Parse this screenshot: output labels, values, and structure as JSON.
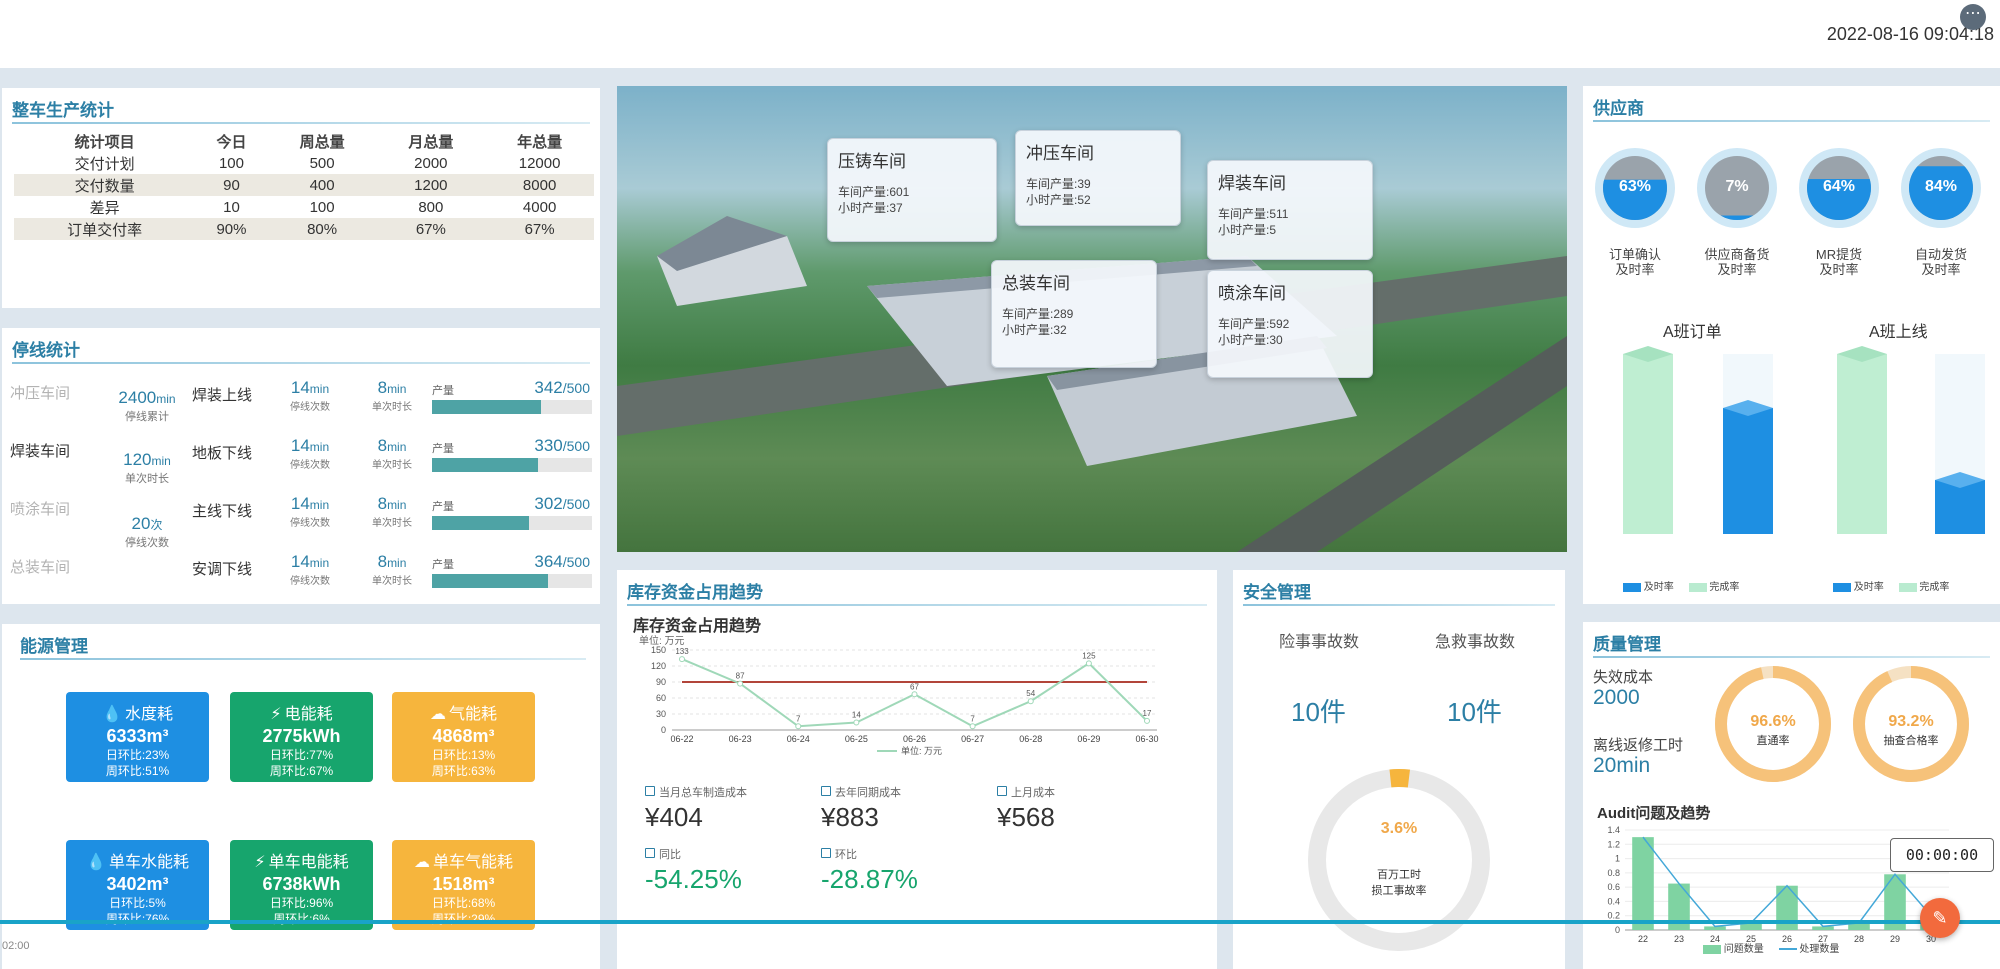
{
  "datetime": "2022-08-16 09:04:18",
  "production": {
    "title": "整车生产统计",
    "headers": [
      "统计项目",
      "今日",
      "周总量",
      "月总量",
      "年总量"
    ],
    "rows": [
      [
        "交付计划",
        "100",
        "500",
        "2000",
        "12000"
      ],
      [
        "交付数量",
        "90",
        "400",
        "1200",
        "8000"
      ],
      [
        "差异",
        "10",
        "100",
        "800",
        "4000"
      ],
      [
        "订单交付率",
        "90%",
        "80%",
        "67%",
        "67%"
      ]
    ]
  },
  "downtime": {
    "title": "停线统计",
    "workshops": [
      {
        "name": "冲压车间",
        "value": "",
        "unit": "",
        "label": ""
      },
      {
        "name": "焊装车间",
        "value": "2400",
        "unit": "min",
        "label": "停线累计"
      },
      {
        "name": "喷涂车间",
        "value": "120",
        "unit": "min",
        "label": "单次时长"
      },
      {
        "name": "总装车间",
        "value": "20",
        "unit": "次",
        "label": "停线次数"
      }
    ],
    "lines": [
      {
        "name": "焊装上线",
        "v1": "14",
        "u1": "min",
        "l1": "停线次数",
        "v2": "8",
        "u2": "min",
        "l2": "单次时长",
        "plabel": "产量",
        "produced": "342",
        "total": "/500",
        "ratio": 0.684
      },
      {
        "name": "地板下线",
        "v1": "14",
        "u1": "min",
        "l1": "停线次数",
        "v2": "8",
        "u2": "min",
        "l2": "单次时长",
        "plabel": "产量",
        "produced": "330",
        "total": "/500",
        "ratio": 0.66
      },
      {
        "name": "主线下线",
        "v1": "14",
        "u1": "min",
        "l1": "停线次数",
        "v2": "8",
        "u2": "min",
        "l2": "单次时长",
        "plabel": "产量",
        "produced": "302",
        "total": "/500",
        "ratio": 0.604
      },
      {
        "name": "安调下线",
        "v1": "14",
        "u1": "min",
        "l1": "停线次数",
        "v2": "8",
        "u2": "min",
        "l2": "单次时长",
        "plabel": "产量",
        "produced": "364",
        "total": "/500",
        "ratio": 0.728
      }
    ]
  },
  "energy": {
    "title": "能源管理",
    "cards": [
      {
        "title": "水度耗",
        "value": "6333m³",
        "s1": "日环比:23%",
        "s2": "周环比:51%",
        "color": "blue",
        "icon": "water-drop-icon",
        "glyph": "💧"
      },
      {
        "title": "电能耗",
        "value": "2775kWh",
        "s1": "日环比:77%",
        "s2": "周环比:67%",
        "color": "green",
        "icon": "lightning-icon",
        "glyph": "⚡"
      },
      {
        "title": "气能耗",
        "value": "4868m³",
        "s1": "日环比:13%",
        "s2": "周环比:63%",
        "color": "orange",
        "icon": "cloud-icon",
        "glyph": "☁"
      },
      {
        "title": "单车水能耗",
        "value": "3402m³",
        "s1": "日环比:5%",
        "s2": "周环比:76%",
        "color": "blue",
        "icon": "water-drop-icon",
        "glyph": "💧"
      },
      {
        "title": "单车电能耗",
        "value": "6738kWh",
        "s1": "日环比:96%",
        "s2": "周环比:6%",
        "color": "green",
        "icon": "lightning-icon",
        "glyph": "⚡"
      },
      {
        "title": "单车气能耗",
        "value": "1518m³",
        "s1": "日环比:68%",
        "s2": "周环比:29%",
        "color": "orange",
        "icon": "cloud-icon",
        "glyph": "☁"
      }
    ]
  },
  "callouts": [
    {
      "title": "压铸车间",
      "l1": "车间产量:601",
      "l2": "小时产量:37"
    },
    {
      "title": "冲压车间",
      "l1": "车间产量:39",
      "l2": "小时产量:52"
    },
    {
      "title": "焊装车间",
      "l1": "车间产量:511",
      "l2": "小时产量:5"
    },
    {
      "title": "总装车间",
      "l1": "车间产量:289",
      "l2": "小时产量:32"
    },
    {
      "title": "喷涂车间",
      "l1": "车间产量:592",
      "l2": "小时产量:30"
    }
  ],
  "inventory": {
    "title": "库存资金占用趋势",
    "chart_title": "库存资金占用趋势",
    "unit": "单位: 万元",
    "kpis": [
      {
        "label": "当月总车制造成本",
        "value": "¥404"
      },
      {
        "label": "去年同期成本",
        "value": "¥883"
      },
      {
        "label": "上月成本",
        "value": "¥568"
      }
    ],
    "pcts": [
      {
        "label": "同比",
        "value": "-54.25%"
      },
      {
        "label": "环比",
        "value": "-28.87%"
      }
    ]
  },
  "chart_data": [
    {
      "type": "line",
      "title": "库存资金占用趋势",
      "ylabel": "单位: 万元",
      "x": [
        "06-22",
        "06-23",
        "06-24",
        "06-25",
        "06-26",
        "06-27",
        "06-28",
        "06-29",
        "06-30"
      ],
      "series": [
        {
          "name": "单位: 万元",
          "values": [
            133,
            87,
            7,
            14,
            67,
            7,
            54,
            125,
            17
          ]
        }
      ],
      "reference_line": 90,
      "ylim": [
        0,
        150
      ],
      "yticks": [
        0,
        15,
        30,
        45,
        60,
        75,
        90,
        105,
        120,
        135,
        150
      ],
      "grid": true,
      "legend": "bottom"
    },
    {
      "type": "bar",
      "title": "Audit问题及趋势",
      "categories": [
        "22",
        "23",
        "24",
        "25",
        "26",
        "27",
        "28",
        "29",
        "30"
      ],
      "series": [
        {
          "name": "问题数量",
          "values": [
            1.3,
            0.65,
            0.05,
            0.1,
            0.62,
            0.05,
            0.1,
            0.78,
            0.2
          ]
        },
        {
          "name": "处理数量",
          "values": [
            1.3,
            0.65,
            0.05,
            0.1,
            0.62,
            0.05,
            0.1,
            0.78,
            0.2
          ]
        }
      ],
      "ylim": [
        0,
        1.4
      ],
      "yticks": [
        0,
        0.2,
        0.4,
        0.6,
        0.8,
        1,
        1.2,
        1.4
      ],
      "legend": "bottom"
    },
    {
      "type": "bar",
      "title": "A班订单",
      "series": [
        {
          "name": "及时率",
          "values": [
            0,
            0.7
          ]
        },
        {
          "name": "完成率",
          "values": [
            1.0,
            0
          ]
        }
      ],
      "legend": "bottom"
    },
    {
      "type": "bar",
      "title": "A班上线",
      "series": [
        {
          "name": "及时率",
          "values": [
            0,
            0.3
          ]
        },
        {
          "name": "完成率",
          "values": [
            1.0,
            0
          ]
        }
      ],
      "legend": "bottom"
    }
  ],
  "safety": {
    "title": "安全管理",
    "items": [
      {
        "label": "险事事故数",
        "value": "10件"
      },
      {
        "label": "急救事故数",
        "value": "10件"
      }
    ],
    "donut": {
      "value": "3.6%",
      "label1": "百万工时",
      "label2": "损工事故率",
      "ratio": 0.036
    }
  },
  "supplier": {
    "title": "供应商",
    "balls": [
      {
        "value": "63%",
        "l1": "订单确认",
        "l2": "及时率",
        "ratio": 0.63
      },
      {
        "value": "7%",
        "l1": "供应商备货",
        "l2": "及时率",
        "ratio": 0.07
      },
      {
        "value": "64%",
        "l1": "MR提货",
        "l2": "及时率",
        "ratio": 0.64
      },
      {
        "value": "84%",
        "l1": "自动发货",
        "l2": "及时率",
        "ratio": 0.84
      }
    ],
    "order_title": "A班订单",
    "online_title": "A班上线",
    "legend_a": "及时率",
    "legend_b": "完成率"
  },
  "quality": {
    "title": "质量管理",
    "failure_label": "失效成本",
    "failure_value": "2000",
    "rework_label": "离线返修工时",
    "rework_value": "20min",
    "rings": [
      {
        "value": "96.6%",
        "label": "直通率",
        "ratio": 0.966
      },
      {
        "value": "93.2%",
        "label": "抽查合格率",
        "ratio": 0.932
      }
    ],
    "audit_title": "Audit问题及趋势",
    "legend_a": "问题数量",
    "legend_b": "处理数量"
  },
  "timer": "00:00:00",
  "playback_time": "02:00",
  "colors": {
    "accent": "#2c7fa5",
    "green": "#17a56d",
    "orange": "#f6b53d",
    "blue": "#1e8fe2",
    "lightgreen": "#9fe0bd"
  }
}
